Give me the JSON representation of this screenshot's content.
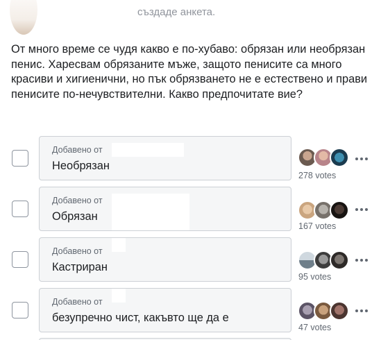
{
  "header": {
    "text": "създаде анкета."
  },
  "post": {
    "text": "От много време се чудя какво е по-хубаво: обрязан или необрязан пенис. Харесвам обрязаните мъже, защото пенисите са много красиви и хигиенични, но пък обрязването не е естествено и прави пенисите по-нечувствителни. Какво предпочитате вие?"
  },
  "poll": {
    "options": [
      {
        "added_by": "Добавено от",
        "label": "Необрязан",
        "votes": "278 votes",
        "checked": false
      },
      {
        "added_by": "Добавено от",
        "label": "Обрязан",
        "votes": "167 votes",
        "checked": false
      },
      {
        "added_by": "Добавено от",
        "label": "Кастриран",
        "votes": "95 votes",
        "checked": false
      },
      {
        "added_by": "Добавено от",
        "label": "безупречно чист, какъвто ще да е",
        "votes": "47 votes",
        "checked": false
      }
    ]
  },
  "colors": {
    "option_bg": "#f5f6f7",
    "option_border": "#ccd0d5",
    "secondary_text": "#606770",
    "header_text": "#90949c"
  },
  "icons": {
    "checkbox": "checkbox-icon",
    "more": "more-options-icon",
    "avatar": "voter-avatar"
  }
}
